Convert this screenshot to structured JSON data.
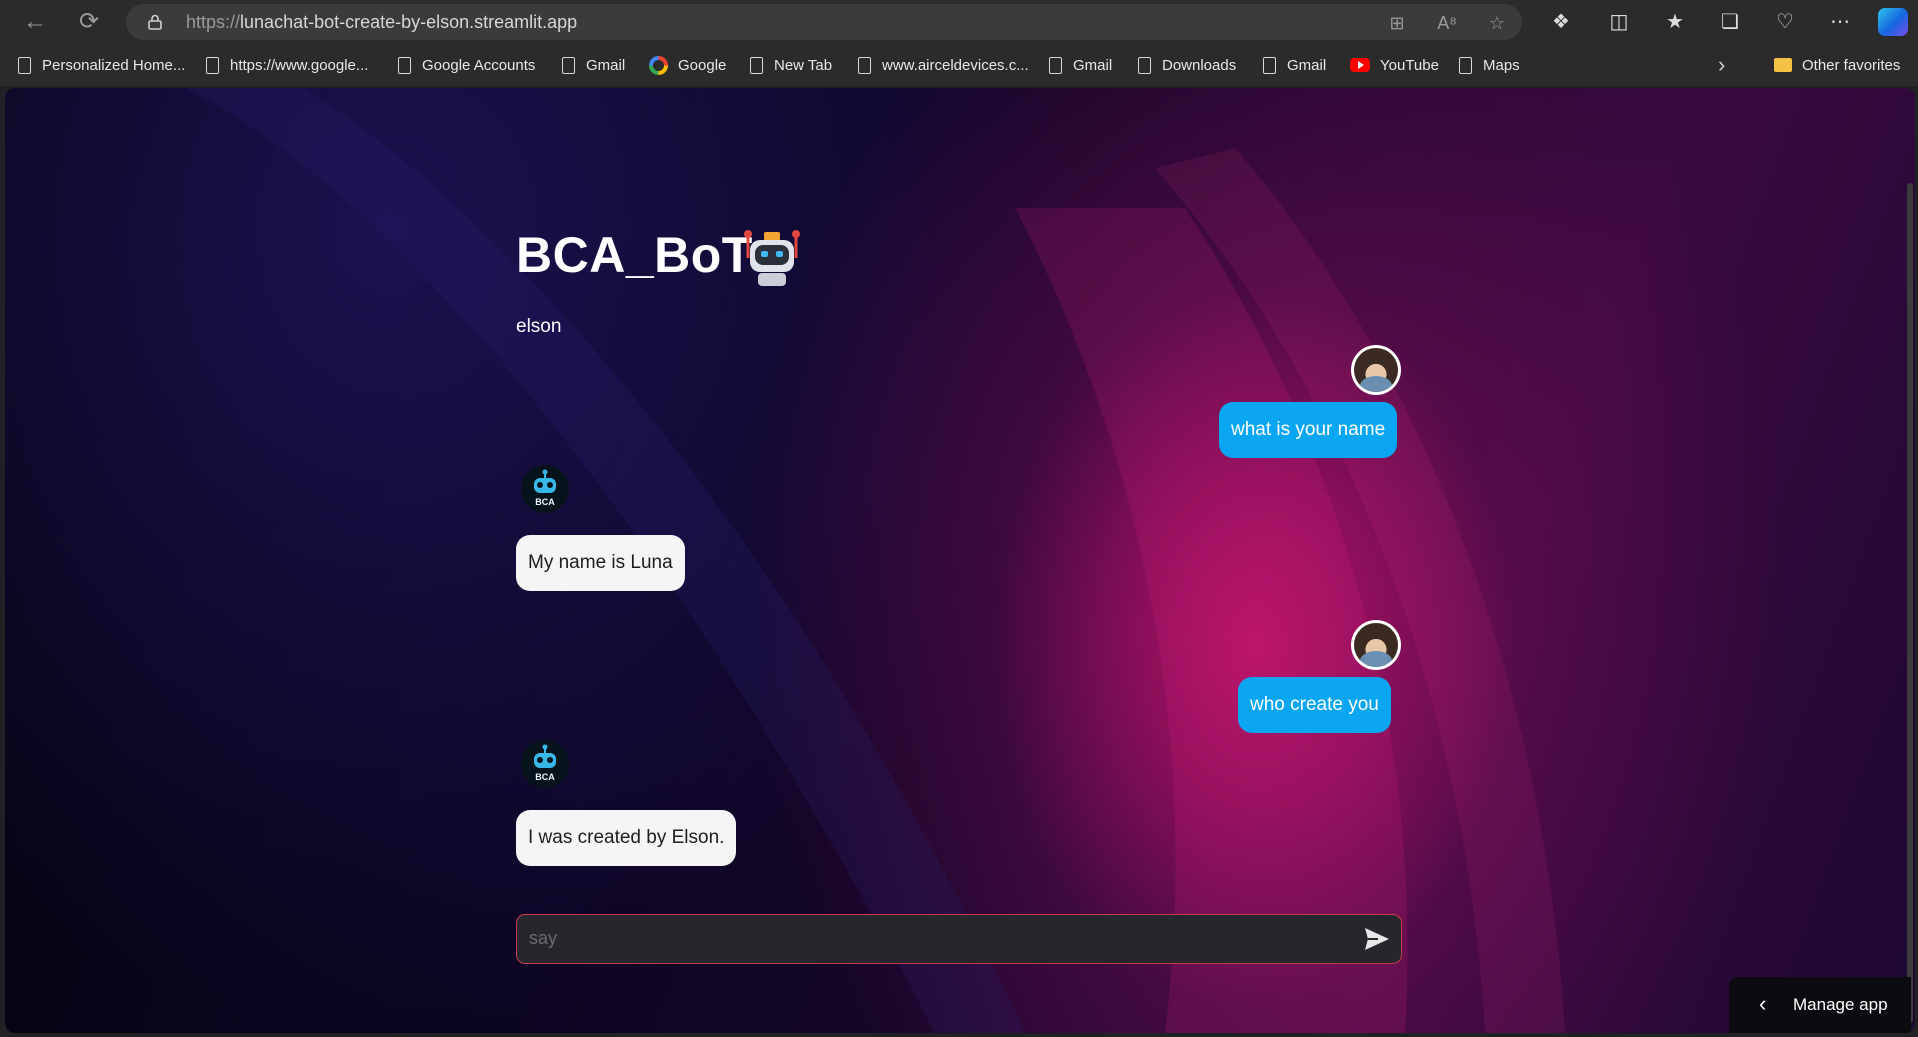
{
  "browser": {
    "url_protocol": "https://",
    "url_host": "lunachat-bot-create-by-elson.streamlit.app",
    "nav": {
      "back_icon": "back-arrow-icon",
      "refresh_icon": "refresh-icon"
    },
    "toolbar_icons": [
      "app-available-icon",
      "read-aloud-icon",
      "favorite-star-icon",
      "extensions-icon",
      "split-screen-icon",
      "favorites-icon",
      "collections-icon",
      "browser-essentials-icon",
      "more-options-icon",
      "copilot-icon"
    ]
  },
  "bookmarks": [
    {
      "label": "Personalized Home...",
      "icon": "page-icon"
    },
    {
      "label": "https://www.google...",
      "icon": "page-icon"
    },
    {
      "label": "Google Accounts",
      "icon": "page-icon"
    },
    {
      "label": "Gmail",
      "icon": "page-icon"
    },
    {
      "label": "Google",
      "icon": "google-icon"
    },
    {
      "label": "New Tab",
      "icon": "page-icon"
    },
    {
      "label": "www.airceldevices.c...",
      "icon": "page-icon"
    },
    {
      "label": "Gmail",
      "icon": "page-icon"
    },
    {
      "label": "Downloads",
      "icon": "page-icon"
    },
    {
      "label": "Gmail",
      "icon": "page-icon"
    },
    {
      "label": "YouTube",
      "icon": "youtube-icon"
    },
    {
      "label": "Maps",
      "icon": "page-icon"
    }
  ],
  "other_favorites": "Other favorites",
  "app": {
    "title": "BCA_BoT",
    "subtitle": "elson",
    "bot_avatar_text": "BCA",
    "messages": [
      {
        "role": "user",
        "text": "what is your name"
      },
      {
        "role": "assistant",
        "text": "My name is Luna"
      },
      {
        "role": "user",
        "text": "who create you"
      },
      {
        "role": "assistant",
        "text": "I was created by Elson."
      }
    ],
    "input_placeholder": "say",
    "manage_app": "Manage app"
  },
  "colors": {
    "user_bubble": "#0aa6f2",
    "bot_bubble": "#f5f5f5",
    "input_border": "#c8394f"
  }
}
